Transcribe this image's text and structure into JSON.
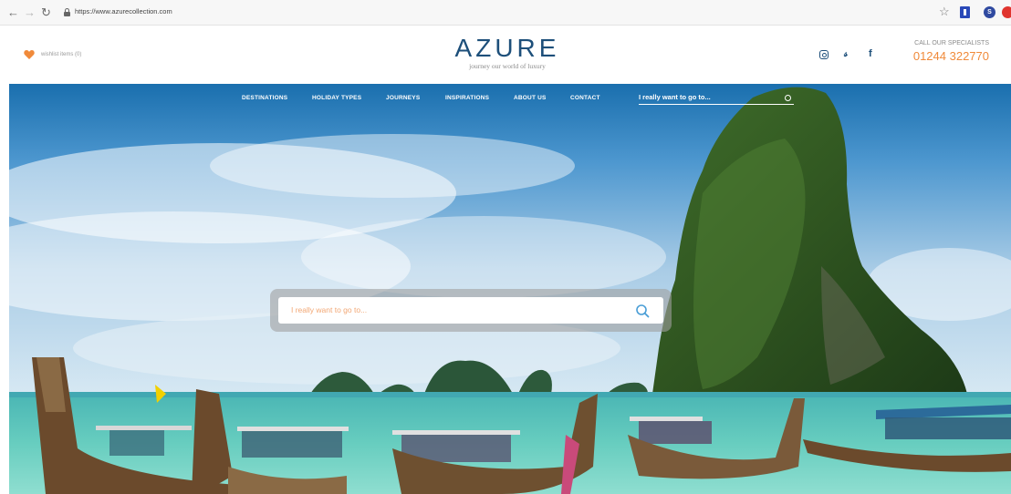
{
  "browser": {
    "url": "https://www.azurecollection.com",
    "icons": [
      "back-arrow-icon",
      "forward-arrow-icon",
      "reload-icon",
      "lock-icon",
      "bookmark-star-icon",
      "extension-icon",
      "extension-icon",
      "extension-icon"
    ]
  },
  "header": {
    "wishlist_label": "wishlist items (0)",
    "logo_title": "AZURE",
    "logo_subtitle": "journey our world of luxury",
    "social_icons": [
      "instagram-icon",
      "twitter-icon",
      "facebook-icon"
    ],
    "call_label": "CALL OUR SPECIALISTS",
    "call_number": "01244 322770"
  },
  "nav": {
    "items": [
      "DESTINATIONS",
      "HOLIDAY TYPES",
      "JOURNEYS",
      "INSPIRATIONS",
      "ABOUT US",
      "CONTACT"
    ],
    "search_placeholder": "I really want to go to..."
  },
  "hero": {
    "search_placeholder": "I really want to go to..."
  },
  "colors": {
    "brand_blue": "#1d4f7a",
    "accent_orange": "#f08a3a",
    "placeholder_orange": "#f2a774"
  }
}
